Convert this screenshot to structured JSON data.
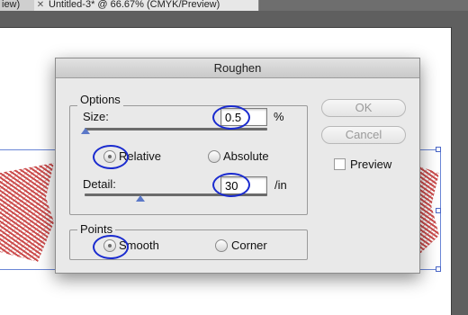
{
  "tabs": [
    {
      "label": "iew)",
      "close": "✕"
    },
    {
      "label": "Untitled-3* @ 66.67% (CMYK/Preview)",
      "close": "✕"
    }
  ],
  "dialog": {
    "title": "Roughen",
    "options": {
      "label": "Options",
      "size_label": "Size:",
      "size_value": "0.5",
      "size_unit": "%",
      "size_slider": 0.02,
      "relative_label": "Relative",
      "absolute_label": "Absolute",
      "selected": "Relative",
      "detail_label": "Detail:",
      "detail_value": "30",
      "detail_unit": "/in",
      "detail_slider": 0.3
    },
    "points": {
      "label": "Points",
      "smooth_label": "Smooth",
      "corner_label": "Corner",
      "selected": "Smooth"
    },
    "ok_label": "OK",
    "cancel_label": "Cancel",
    "preview_label": "Preview",
    "preview_checked": false
  },
  "colors": {
    "artwork": "#c73a3a",
    "annotation_ring": "#1a2bcf",
    "selection_guide": "#6a86d6"
  }
}
